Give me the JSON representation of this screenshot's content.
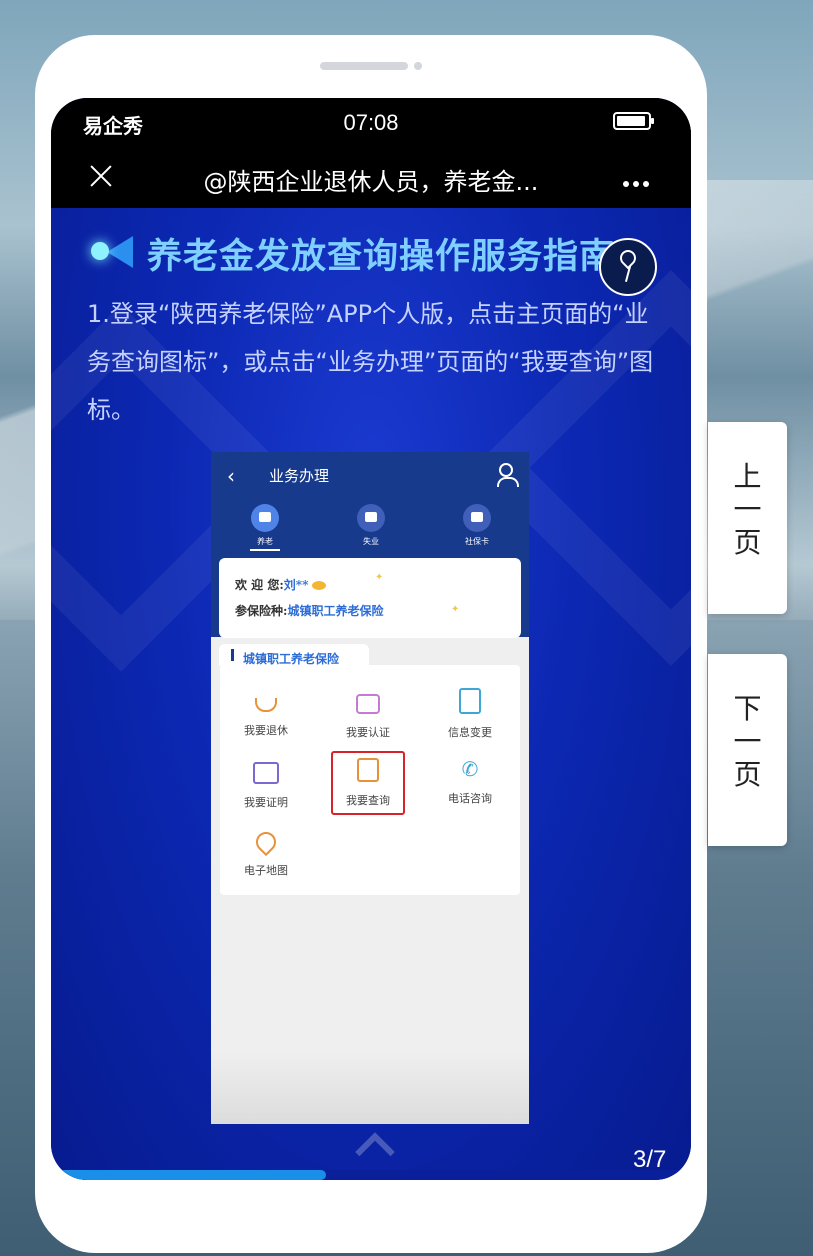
{
  "status_bar": {
    "carrier": "易企秀",
    "time": "07:08"
  },
  "nav": {
    "title": "@陕西企业退休人员，养老金...",
    "close_icon": "close-icon",
    "more_icon": "more-icon"
  },
  "content": {
    "heading": "养老金发放查询操作服务指南",
    "description": "1.登录“陕西养老保险”APP个人版，点击主页面的“业务查询图标”，或点击“业务办理”页面的“我要查询”图标。"
  },
  "inner_app": {
    "title": "业务办理",
    "tabs": [
      {
        "label": "养老"
      },
      {
        "label": "失业"
      },
      {
        "label": "社保卡"
      }
    ],
    "welcome_prefix": "欢 迎 您:",
    "user": "刘**",
    "insurance_prefix": "参保险种:",
    "insurance_type": "城镇职工养老保险",
    "section_title": "城镇职工养老保险",
    "grid": [
      {
        "label": "我要退休",
        "icon": "cup-icon"
      },
      {
        "label": "我要认证",
        "icon": "camera-icon"
      },
      {
        "label": "信息变更",
        "icon": "document-edit-icon"
      },
      {
        "label": "我要证明",
        "icon": "certificate-icon"
      },
      {
        "label": "我要查询",
        "icon": "query-icon"
      },
      {
        "label": "电话咨询",
        "icon": "phone-icon"
      },
      {
        "label": "电子地图",
        "icon": "map-pin-icon"
      }
    ],
    "highlighted_item": "我要查询"
  },
  "pager": {
    "text": "3/7",
    "progress_fraction": 0.43
  },
  "side_buttons": {
    "prev": "上一页",
    "next": "下一页"
  },
  "colors": {
    "heading": "#7fd0ff",
    "screen_bg": "#0a1f9a",
    "highlight": "#d9232a",
    "progress": "#1a8fe8"
  }
}
